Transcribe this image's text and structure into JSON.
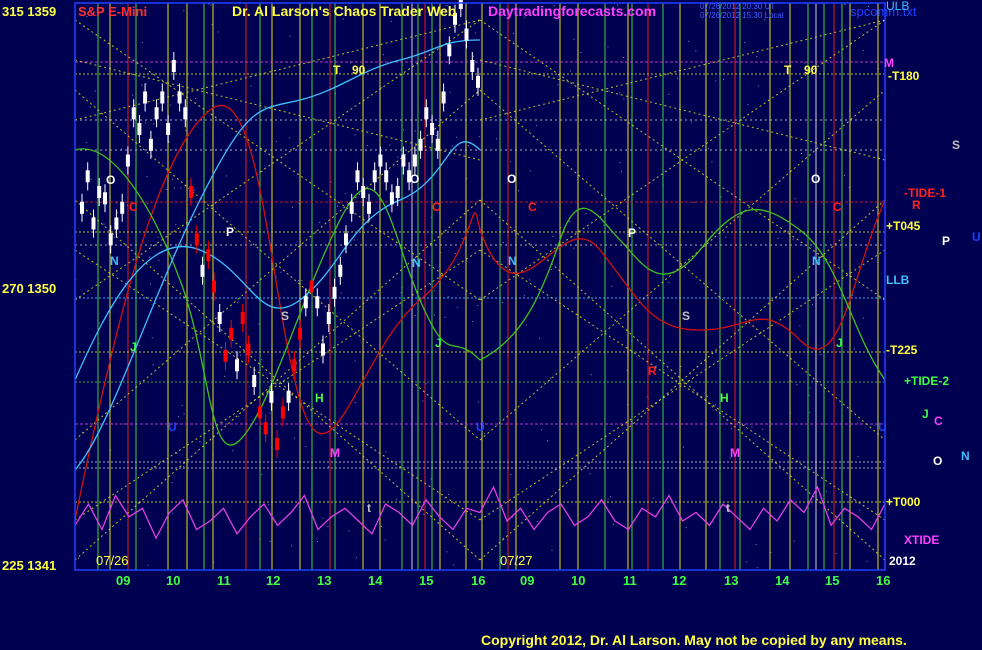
{
  "header": {
    "y_top_label": "315  1359",
    "title_left": "S&P E-Mini",
    "title_main": "Dr. Al Larson's Chaos Trader Web",
    "site": "Daytradingforecasts.com",
    "timestamp_1": "07/26/2012 20:30 UT",
    "timestamp_2": "07/26/2012 15:30 Local",
    "filename": "spcomm.txt",
    "ulb": "ULB"
  },
  "colors": {
    "background": "#000050",
    "price_up": "#ffffff",
    "price_down": "#ff0000",
    "ma_red": "#d01010",
    "ma_green": "#40c020",
    "ma_cyan": "#40c0ff",
    "xtide": "#e040e0",
    "grid_green": "#40c040",
    "grid_yellow": "#d0d020"
  },
  "left_axis": {
    "top": "315  1359",
    "mid": "270  1350",
    "bottom": "225  1341"
  },
  "right_labels": [
    {
      "text": "M",
      "color": "#ff40ff"
    },
    {
      "text": "-T180",
      "color": "#ffff40"
    },
    {
      "text": "S",
      "color": "#c0c0c0"
    },
    {
      "text": "-TIDE-1",
      "color": "#ff2020"
    },
    {
      "text": "R",
      "color": "#ff2020"
    },
    {
      "text": "+T045",
      "color": "#ffff40"
    },
    {
      "text": "P",
      "color": "#ffffff"
    },
    {
      "text": "U",
      "color": "#2040ff"
    },
    {
      "text": "LLB",
      "color": "#40c0ff"
    },
    {
      "text": "-T225",
      "color": "#ffff40"
    },
    {
      "text": "+TIDE-2",
      "color": "#40ff40"
    },
    {
      "text": "J",
      "color": "#40ff40"
    },
    {
      "text": "C",
      "color": "#ff40ff"
    },
    {
      "text": "O",
      "color": "#ffffff"
    },
    {
      "text": "N",
      "color": "#40c0ff"
    },
    {
      "text": "+T000",
      "color": "#ffff40"
    },
    {
      "text": "XTIDE",
      "color": "#ff40ff"
    },
    {
      "text": "2012",
      "color": "#ffffff"
    }
  ],
  "dates": {
    "day1": "07/26",
    "day2": "07/27"
  },
  "x_ticks": [
    "09",
    "10",
    "11",
    "12",
    "13",
    "14",
    "15",
    "16",
    "09",
    "10",
    "11",
    "12",
    "13",
    "14",
    "15",
    "16"
  ],
  "planet_labels": [
    {
      "text": "T",
      "color": "#ffff40"
    },
    {
      "text": "90",
      "color": "#ffff40"
    },
    {
      "text": "T",
      "color": "#ffff40"
    },
    {
      "text": "90",
      "color": "#ffff40"
    },
    {
      "text": "O",
      "color": "#ffffff"
    },
    {
      "text": "O",
      "color": "#ffffff"
    },
    {
      "text": "O",
      "color": "#ffffff"
    },
    {
      "text": "O",
      "color": "#ffffff"
    },
    {
      "text": "C",
      "color": "#ff2020"
    },
    {
      "text": "C",
      "color": "#ff2020"
    },
    {
      "text": "C",
      "color": "#ff2020"
    },
    {
      "text": "C",
      "color": "#ff2020"
    },
    {
      "text": "P",
      "color": "#ffffff"
    },
    {
      "text": "P",
      "color": "#ffffff"
    },
    {
      "text": "N",
      "color": "#40c0ff"
    },
    {
      "text": "N",
      "color": "#40c0ff"
    },
    {
      "text": "N",
      "color": "#40c0ff"
    },
    {
      "text": "N",
      "color": "#40c0ff"
    },
    {
      "text": "J",
      "color": "#40ff40"
    },
    {
      "text": "J",
      "color": "#40ff40"
    },
    {
      "text": "J",
      "color": "#40ff40"
    },
    {
      "text": "S",
      "color": "#c0c0c0"
    },
    {
      "text": "S",
      "color": "#c0c0c0"
    },
    {
      "text": "H",
      "color": "#40ff40"
    },
    {
      "text": "H",
      "color": "#40ff40"
    },
    {
      "text": "M",
      "color": "#ff40ff"
    },
    {
      "text": "M",
      "color": "#ff40ff"
    },
    {
      "text": "R",
      "color": "#ff2020"
    },
    {
      "text": "U",
      "color": "#2040ff"
    },
    {
      "text": "U",
      "color": "#2040ff"
    },
    {
      "text": "U",
      "color": "#2040ff"
    },
    {
      "text": "t",
      "color": "#c0c0c0"
    },
    {
      "text": "t",
      "color": "#c0c0c0"
    }
  ],
  "footer": {
    "copyright": "Copyright 2012, Dr. Al Larson. May not be copied by any means."
  },
  "chart_data": {
    "type": "line",
    "title": "S&P E-Mini",
    "ylim": [
      1341,
      1359
    ],
    "ylim_secondary": [
      225,
      315
    ],
    "price_series": [
      1352.5,
      1353.5,
      1352,
      1353,
      1352.8,
      1351.5,
      1352,
      1352.5,
      1354,
      1355.5,
      1355,
      1356,
      1354.5,
      1355.5,
      1356,
      1355,
      1357,
      1356,
      1355.5,
      1353,
      1351.5,
      1350.5,
      1351,
      1350,
      1349,
      1347.8,
      1348.5,
      1347.5,
      1349,
      1348,
      1347,
      1346,
      1345.5,
      1346.5,
      1345,
      1346,
      1346.5,
      1347.5,
      1348.5,
      1349.5,
      1350,
      1349.5,
      1348,
      1349,
      1349.8,
      1350.5,
      1351.5,
      1352.5,
      1353.5,
      1353,
      1352.5,
      1353.5,
      1354,
      1353.5,
      1352.8,
      1353,
      1354,
      1353.5,
      1354,
      1354.5,
      1355.5,
      1355,
      1354.5,
      1356,
      1357.5,
      1358.5,
      1359,
      1358,
      1357,
      1356.5
    ],
    "down_range": [
      18,
      40
    ],
    "xtide_series": [
      0.35,
      0.6,
      0.3,
      0.7,
      0.45,
      0.55,
      0.2,
      0.5,
      0.65,
      0.3,
      0.4,
      0.55,
      0.25,
      0.45,
      0.6,
      0.35,
      0.5,
      0.7,
      0.3,
      0.45,
      0.55,
      0.4,
      0.25,
      0.6,
      0.5,
      0.35,
      0.65,
      0.45,
      0.3,
      0.55,
      0.5,
      0.8,
      0.4,
      0.55,
      0.3,
      0.5,
      0.6,
      0.35,
      0.45,
      0.65,
      0.4,
      0.3,
      0.55,
      0.45,
      0.7,
      0.4,
      0.5,
      0.35,
      0.6,
      0.45,
      0.3,
      0.55,
      0.4,
      0.65,
      0.5,
      0.8,
      0.35,
      0.55,
      0.45,
      0.3,
      0.6
    ]
  }
}
